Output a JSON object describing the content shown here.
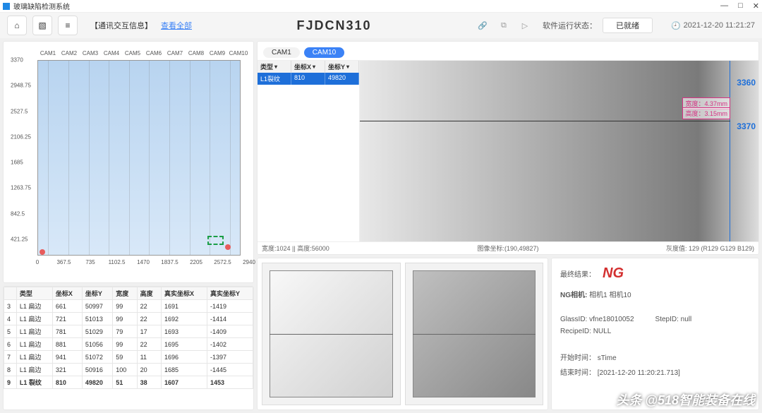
{
  "titlebar": {
    "title": "玻璃缺陷检测系统"
  },
  "toolbar": {
    "comm_label": "【通讯交互信息】",
    "comm_link": "查看全部",
    "center_title": "FJDCN310",
    "status_label": "软件运行状态：",
    "status_value": "已就绪",
    "clock": "2021-12-20 11:21:27"
  },
  "chart_data": {
    "type": "scatter",
    "cam_labels": [
      "CAM1",
      "CAM2",
      "CAM3",
      "CAM4",
      "CAM5",
      "CAM6",
      "CAM7",
      "CAM8",
      "CAM9",
      "CAM10"
    ],
    "x_ticks": [
      "0",
      "367.5",
      "735",
      "1102.5",
      "1470",
      "1837.5",
      "2205",
      "2572.5",
      "2940"
    ],
    "y_ticks": [
      "3370",
      "2948.75",
      "2527.5",
      "2106.25",
      "1685",
      "1263.75",
      "842.5",
      "421.25"
    ],
    "points": [
      {
        "x_frac": 0.02,
        "y_frac": 0.985
      },
      {
        "x_frac": 0.94,
        "y_frac": 0.96
      }
    ],
    "roi_rect": {
      "x_frac": 0.84,
      "y_frac": 0.9,
      "w_frac": 0.08,
      "h_frac": 0.05
    }
  },
  "bottom_table": {
    "headers": [
      "",
      "类型",
      "坐标X",
      "坐标Y",
      "宽度",
      "高度",
      "真实坐标X",
      "真实坐标Y"
    ],
    "rows": [
      [
        "3",
        "L1 扁边",
        "661",
        "50997",
        "99",
        "22",
        "1691",
        "-1419"
      ],
      [
        "4",
        "L1 扁边",
        "721",
        "51013",
        "99",
        "22",
        "1692",
        "-1414"
      ],
      [
        "5",
        "L1 扁边",
        "781",
        "51029",
        "79",
        "17",
        "1693",
        "-1409"
      ],
      [
        "6",
        "L1 扁边",
        "881",
        "51056",
        "99",
        "22",
        "1695",
        "-1402"
      ],
      [
        "7",
        "L1 扁边",
        "941",
        "51072",
        "59",
        "11",
        "1696",
        "-1397"
      ],
      [
        "8",
        "L1 扁边",
        "321",
        "50916",
        "100",
        "20",
        "1685",
        "-1445"
      ],
      [
        "9",
        "L1 裂纹",
        "810",
        "49820",
        "51",
        "38",
        "1607",
        "1453"
      ]
    ],
    "highlight_row": 6
  },
  "right_top": {
    "tabs": [
      "CAM1",
      "CAM10"
    ],
    "active_tab": 1,
    "small_table": {
      "headers": [
        "类型",
        "坐标X",
        "坐标Y"
      ],
      "row": [
        "L1裂纹",
        "810",
        "49820"
      ]
    },
    "dim1_label": "宽度：",
    "dim1_val": "4.37mm",
    "dim2_label": "高度：",
    "dim2_val": "3.15mm",
    "num1": "3360",
    "num2": "3370",
    "info_width": "宽度:1024 || 高度:56000",
    "info_coord": "图像坐标:(190,49827)",
    "info_gray": "灰度值: 129 (R129 G129 B129)"
  },
  "right_bottom": {
    "result_label": "最终结果：",
    "result_value": "NG",
    "ng_cam_label": "NG相机:",
    "ng_cam_value": "相机1 相机10",
    "glass_id_label": "GlassID:",
    "glass_id_value": "vfne18010052",
    "step_id_label": "StepID:",
    "step_id_value": "null",
    "recipe_label": "RecipeID:",
    "recipe_value": "NULL",
    "start_label": "开始时间：",
    "start_value": "sTime",
    "end_label": "结束时间：",
    "end_value": "[2021-12-20 11:20:21.713]"
  },
  "watermark": "头条 @518智能装备在线"
}
